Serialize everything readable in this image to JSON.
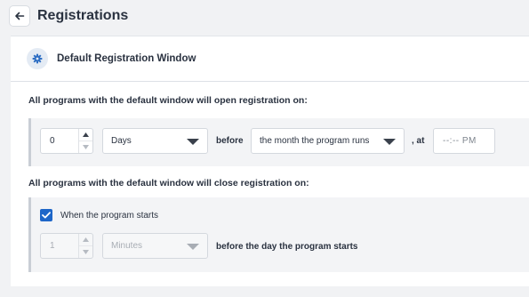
{
  "header": {
    "title": "Registrations",
    "back_icon": "arrow-left-icon"
  },
  "card": {
    "title": "Default Registration Window",
    "icon": "gear-icon",
    "open": {
      "label": "All programs with the default window will open registration on:",
      "quantity": "0",
      "unit_select": "Days",
      "connector": "before",
      "reference_select": "the month the program runs",
      "at_text": ", at",
      "time_value": "--:-- PM"
    },
    "close": {
      "label": "All programs with the default window will close registration on:",
      "checkbox_label": "When the program starts",
      "checkbox_checked": true,
      "quantity": "1",
      "unit_select": "Minutes",
      "suffix": "before the day the program starts"
    }
  },
  "colors": {
    "accent": "#1e66c8",
    "background": "#f1f2f4"
  }
}
